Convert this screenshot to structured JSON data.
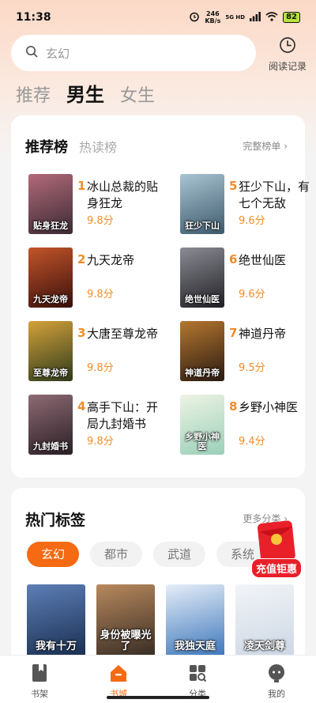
{
  "status_bar": {
    "time": "11:38",
    "net_speed_value": "246",
    "net_speed_unit": "KB/s",
    "signal": "5G HD",
    "battery": "82"
  },
  "search": {
    "placeholder": "玄幻"
  },
  "history": {
    "label": "阅读记录"
  },
  "gender_tabs": [
    {
      "label": "推荐",
      "active": false
    },
    {
      "label": "男生",
      "active": true
    },
    {
      "label": "女生",
      "active": false
    }
  ],
  "ranking": {
    "tabs": [
      "推荐榜",
      "热读榜"
    ],
    "more": "完整榜单 ›",
    "items": [
      {
        "rank": "1",
        "title": "冰山总裁的贴身狂龙",
        "score": "9.8分",
        "cover_text": "贴身狂龙",
        "cover_colors": [
          "#3a2a34",
          "#b36a7a"
        ]
      },
      {
        "rank": "2",
        "title": "九天龙帝",
        "score": "9.8分",
        "cover_text": "九天龙帝",
        "cover_colors": [
          "#3a0f0c",
          "#c2552a"
        ]
      },
      {
        "rank": "3",
        "title": "大唐至尊龙帝",
        "score": "9.8分",
        "cover_text": "至尊龙帝",
        "cover_colors": [
          "#2e3b1c",
          "#d4a13a"
        ]
      },
      {
        "rank": "4",
        "title": "高手下山：开局九封婚书",
        "score": "9.8分",
        "cover_text": "九封婚书",
        "cover_colors": [
          "#2a1f25",
          "#8e6a74"
        ]
      },
      {
        "rank": "5",
        "title": "狂少下山，有七个无敌",
        "score": "9.6分",
        "cover_text": "狂少下山",
        "cover_colors": [
          "#3d5a6c",
          "#a9c4d2"
        ]
      },
      {
        "rank": "6",
        "title": "绝世仙医",
        "score": "9.6分",
        "cover_text": "绝世仙医",
        "cover_colors": [
          "#1f1f24",
          "#8b8b93"
        ]
      },
      {
        "rank": "7",
        "title": "神道丹帝",
        "score": "9.5分",
        "cover_text": "神道丹帝",
        "cover_colors": [
          "#2a1a12",
          "#b5772f"
        ]
      },
      {
        "rank": "8",
        "title": "乡野小神医",
        "score": "9.4分",
        "cover_text": "乡野小神医",
        "cover_colors": [
          "#9ad0b8",
          "#eef3e4"
        ]
      }
    ]
  },
  "hot_tags": {
    "title": "热门标签",
    "more": "更多分类 ›",
    "tags": [
      {
        "label": "玄幻",
        "active": true
      },
      {
        "label": "都市",
        "active": false
      },
      {
        "label": "武道",
        "active": false
      },
      {
        "label": "系统",
        "active": false
      }
    ],
    "books": [
      {
        "cover_text": "我有十万",
        "cover_colors": [
          "#142849",
          "#5d7fb6"
        ]
      },
      {
        "cover_text": "身份被曝光了",
        "cover_colors": [
          "#2d2520",
          "#b8895d"
        ]
      },
      {
        "cover_text": "我独天庭",
        "cover_colors": [
          "#2f6db6",
          "#e6eef8"
        ]
      },
      {
        "cover_text": "凌天剑尊",
        "cover_colors": [
          "#c9d5e3",
          "#f2f4f7"
        ]
      }
    ]
  },
  "promo": {
    "label": "充值钜惠"
  },
  "bottom_nav": [
    {
      "label": "书架",
      "icon": "bookshelf-icon",
      "active": false
    },
    {
      "label": "书城",
      "icon": "bookstore-icon",
      "active": true
    },
    {
      "label": "分类",
      "icon": "category-icon",
      "active": false
    },
    {
      "label": "我的",
      "icon": "profile-icon",
      "active": false
    }
  ],
  "colors": {
    "accent": "#f56a12",
    "score": "#f08c28"
  }
}
